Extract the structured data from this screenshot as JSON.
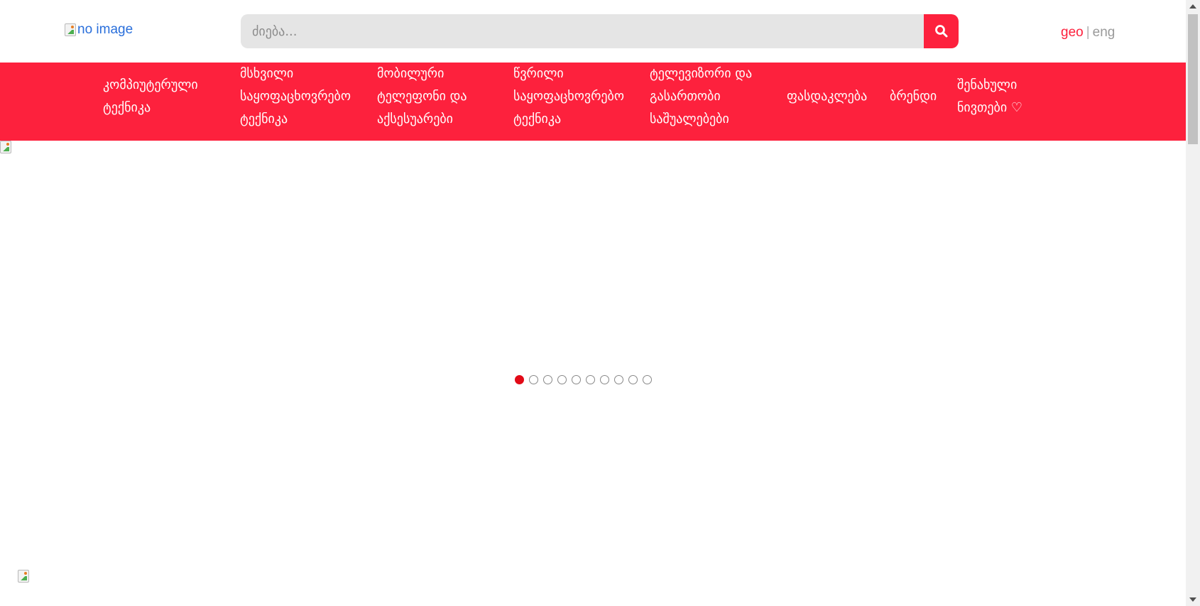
{
  "header": {
    "logo_alt": "no image",
    "search": {
      "placeholder": "ძიება...",
      "value": ""
    },
    "lang": {
      "active": "geo",
      "separator": "|",
      "other": "eng"
    }
  },
  "nav": {
    "items": [
      {
        "lines": [
          "კომპიუტერული",
          "ტექნიკა"
        ]
      },
      {
        "lines": [
          "მსხვილი",
          "საყოფაცხოვრებო",
          "ტექნიკა"
        ]
      },
      {
        "lines": [
          "მობილური",
          "ტელეფონი და",
          "აქსესუარები"
        ]
      },
      {
        "lines": [
          "წვრილი",
          "საყოფაცხოვრებო",
          "ტექნიკა"
        ]
      },
      {
        "lines": [
          "ტელევიზორი და",
          "გასართობი",
          "საშუალებები"
        ]
      },
      {
        "lines": [
          "ფასდაკლება"
        ]
      },
      {
        "lines": [
          "ბრენდი"
        ]
      },
      {
        "lines": [
          "შენახული",
          "ნივთები ♡"
        ]
      }
    ]
  },
  "slider": {
    "dot_count": 10,
    "active_index": 0
  },
  "colors": {
    "accent": "#fd213d",
    "dot_active": "#e20a17"
  },
  "icons": {
    "search": "search-icon",
    "heart": "heart-icon"
  }
}
